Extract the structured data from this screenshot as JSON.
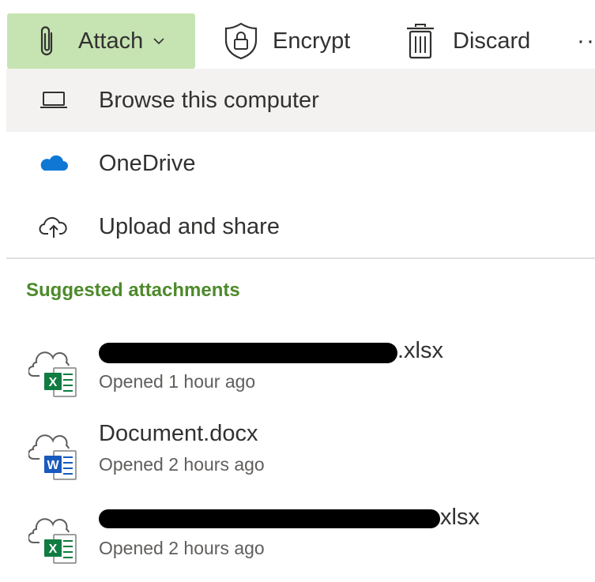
{
  "toolbar": {
    "attach_label": "Attach",
    "encrypt_label": "Encrypt",
    "discard_label": "Discard",
    "more_label": "··",
    "accent_color": "#c6e3b2"
  },
  "attach_menu": {
    "items": [
      {
        "label": "Browse this computer",
        "icon": "laptop-icon"
      },
      {
        "label": "OneDrive",
        "icon": "onedrive-cloud-icon"
      },
      {
        "label": "Upload and share",
        "icon": "cloud-upload-icon"
      }
    ]
  },
  "suggested": {
    "title": "Suggested attachments",
    "title_color": "#4d8a2b",
    "files": [
      {
        "name": ".xlsx",
        "meta": "Opened 1 hour ago",
        "type": "excel",
        "name_redacted": true
      },
      {
        "name": "Document.docx",
        "meta": "Opened 2 hours ago",
        "type": "word",
        "name_redacted": false
      },
      {
        "name": "xlsx",
        "meta": "Opened 2 hours ago",
        "type": "excel",
        "name_redacted": true
      }
    ]
  }
}
